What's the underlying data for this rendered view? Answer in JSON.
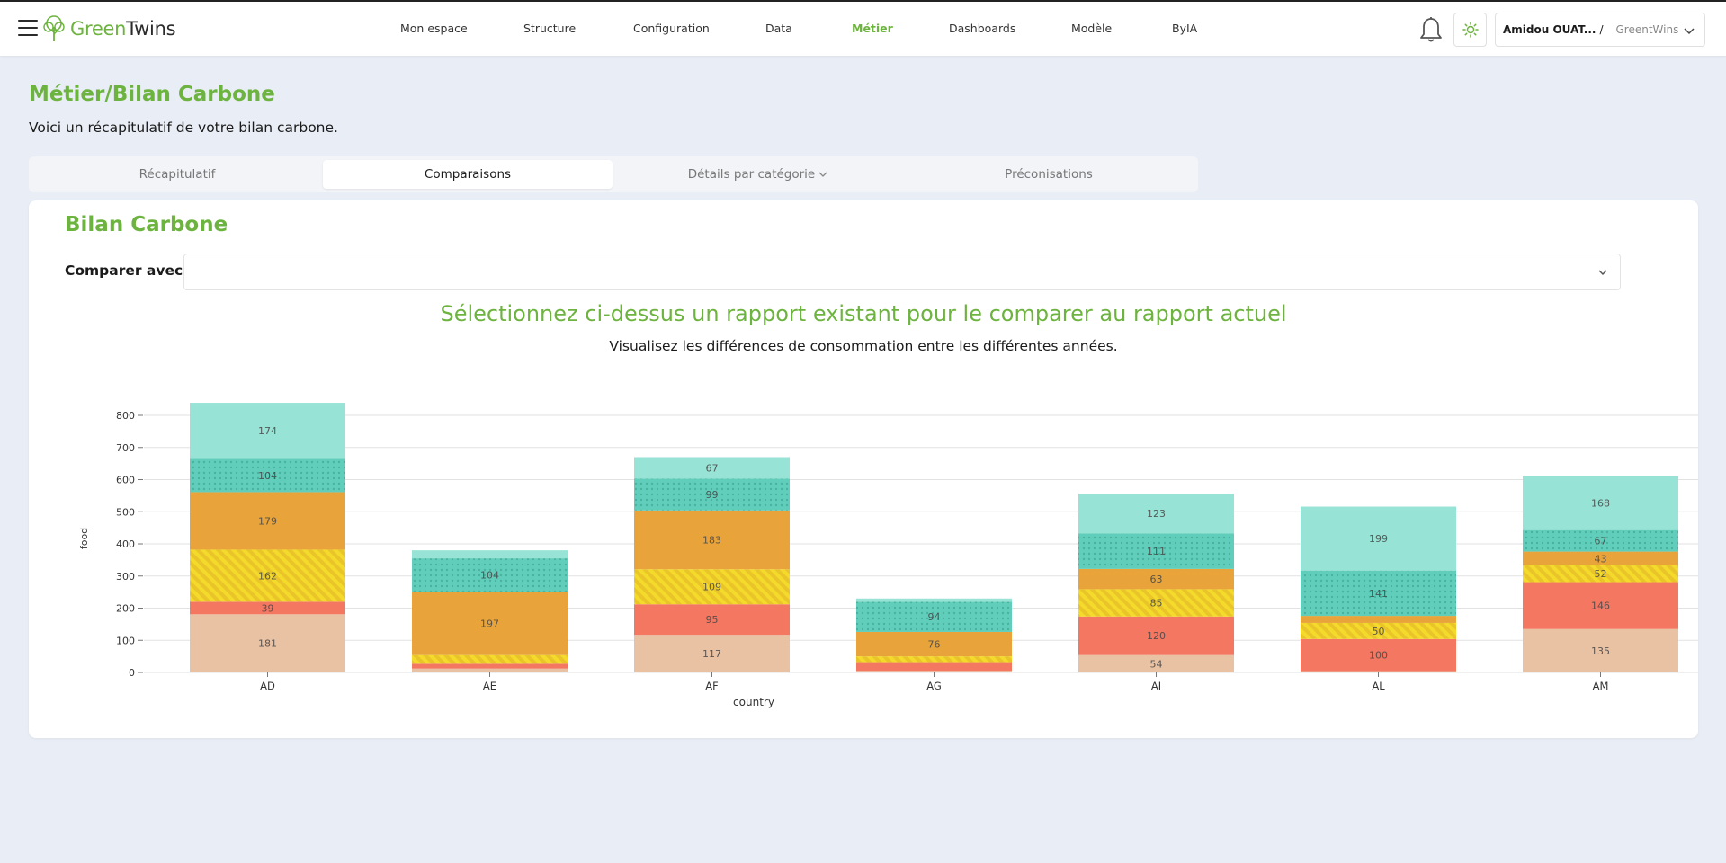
{
  "header": {
    "logo_green": "Green",
    "logo_dark": "Twins",
    "nav": [
      {
        "label": "Mon espace",
        "active": false
      },
      {
        "label": "Structure",
        "active": false
      },
      {
        "label": "Configuration",
        "active": false
      },
      {
        "label": "Data",
        "active": false
      },
      {
        "label": "Métier",
        "active": true
      },
      {
        "label": "Dashboards",
        "active": false
      },
      {
        "label": "Modèle",
        "active": false
      },
      {
        "label": "ByIA",
        "active": false
      }
    ],
    "user": {
      "name": "Amidou OUAT...",
      "separator": "/",
      "org": "GreentWins"
    }
  },
  "page": {
    "title": "Métier/Bilan Carbone",
    "subtitle": "Voici un récapitulatif de votre bilan carbone."
  },
  "tabs": [
    {
      "label": "Récapitulatif",
      "active": false
    },
    {
      "label": "Comparaisons",
      "active": true
    },
    {
      "label": "Détails par catégorie",
      "active": false,
      "has_dropdown": true
    },
    {
      "label": "Préconisations",
      "active": false
    }
  ],
  "card": {
    "title": "Bilan Carbone",
    "compare_label": "Comparer avec",
    "compare_value": "",
    "cta_title": "Sélectionnez ci-dessus un rapport existant pour le comparer au rapport actuel",
    "cta_subtitle": "Visualisez les différences de consommation entre les différentes années."
  },
  "colors": {
    "accent": "#6db33f",
    "series": [
      "#e9c1a3",
      "#f47762",
      "#f4da2a",
      "#e8a43a",
      "#61cdbb",
      "#97e3d5"
    ]
  },
  "chart_data": {
    "type": "bar",
    "stacked": true,
    "xlabel": "country",
    "ylabel": "food",
    "ylim": [
      0,
      800
    ],
    "yticks": [
      0,
      100,
      200,
      300,
      400,
      500,
      600,
      700,
      800
    ],
    "grid": true,
    "categories": [
      "AD",
      "AE",
      "AF",
      "AG",
      "AI",
      "AL",
      "AM"
    ],
    "series": [
      {
        "values": [
          181,
          12,
          117,
          5,
          54,
          4,
          135
        ],
        "color": "#e9c1a3",
        "pattern": "none"
      },
      {
        "values": [
          39,
          15,
          95,
          27,
          120,
          100,
          146
        ],
        "color": "#f47762",
        "pattern": "none"
      },
      {
        "values": [
          162,
          27,
          109,
          18,
          85,
          50,
          52
        ],
        "color": "#f4da2a",
        "pattern": "lines"
      },
      {
        "values": [
          179,
          197,
          183,
          76,
          63,
          22,
          43
        ],
        "color": "#e8a43a",
        "pattern": "none"
      },
      {
        "values": [
          104,
          104,
          99,
          94,
          111,
          141,
          67
        ],
        "color": "#61cdbb",
        "pattern": "dots"
      },
      {
        "values": [
          174,
          25,
          67,
          10,
          123,
          199,
          168
        ],
        "color": "#97e3d5",
        "pattern": "none"
      }
    ]
  }
}
